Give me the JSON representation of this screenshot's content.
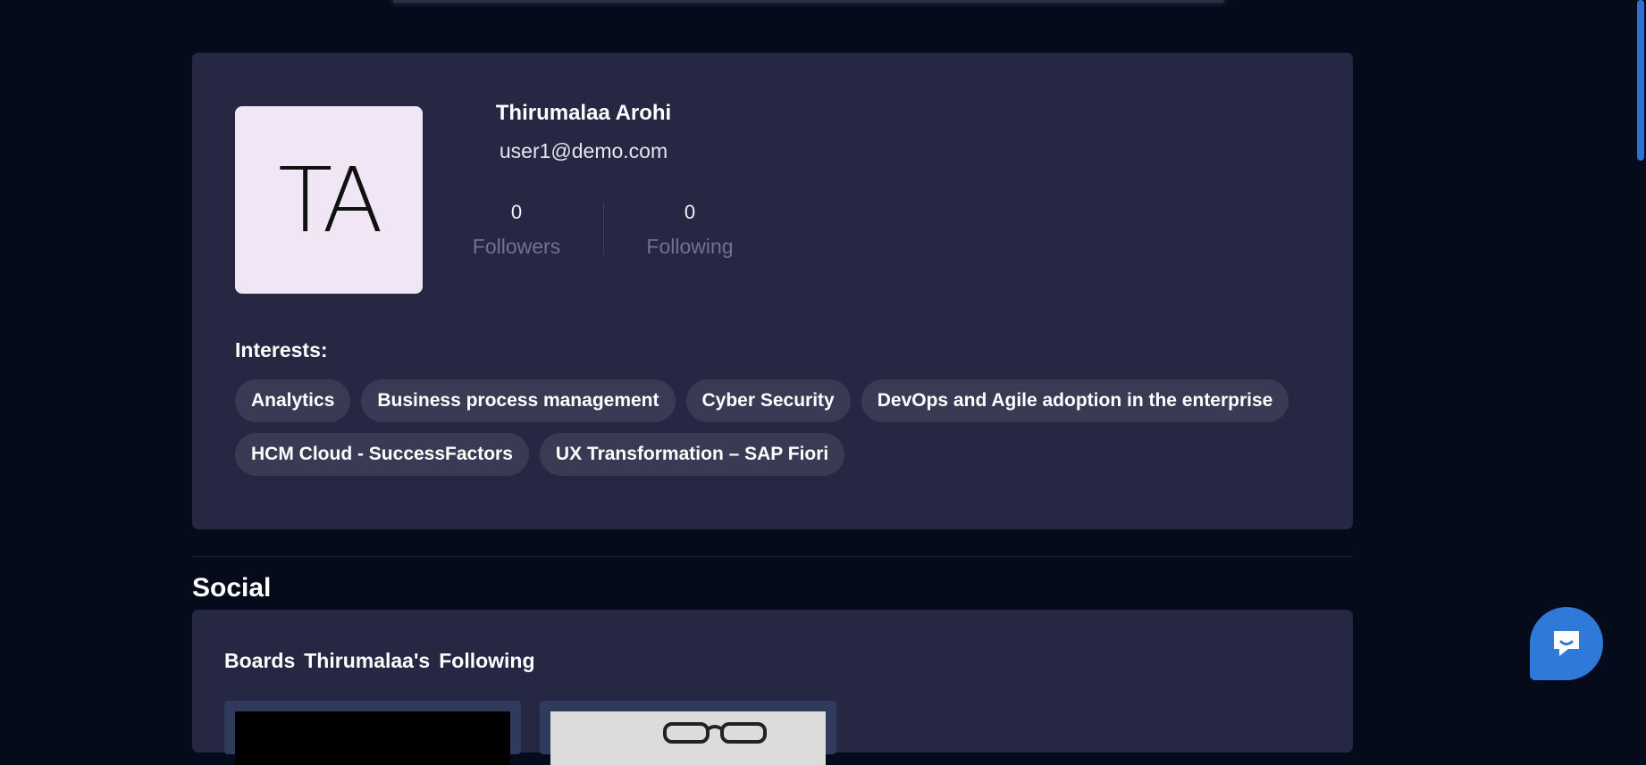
{
  "profile": {
    "avatar_initials": "TA",
    "name": "Thirumalaa Arohi",
    "email": "user1@demo.com",
    "followers_count": "0",
    "followers_label": "Followers",
    "following_count": "0",
    "following_label": "Following"
  },
  "interests": {
    "title": "Interests:",
    "items": [
      "Analytics",
      "Business process management",
      "Cyber Security",
      "DevOps and Agile adoption in the enterprise",
      "HCM Cloud - SuccessFactors",
      "UX Transformation – SAP Fiori"
    ]
  },
  "social": {
    "title": "Social",
    "tabs": [
      "Boards",
      "Thirumalaa's",
      "Following"
    ]
  },
  "chat": {
    "icon": "chat-bubble-icon"
  },
  "colors": {
    "page_bg": "#050b1a",
    "card_bg": "#262742",
    "chip_bg": "#3a3a54",
    "avatar_bg": "#f1e6f5",
    "accent": "#2f7ad8"
  }
}
